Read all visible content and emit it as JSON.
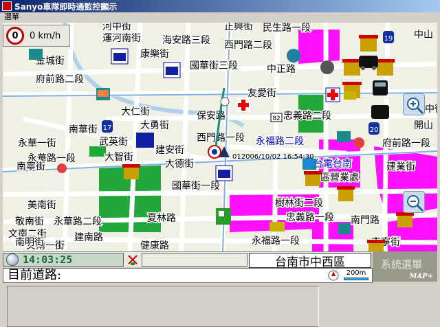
{
  "window": {
    "title": "Sanyo車隊即時通監控顯示"
  },
  "menu": {
    "items": [
      "選單"
    ]
  },
  "speed": {
    "value": "0",
    "unit": "0 km/h"
  },
  "map": {
    "timestamp_label": "012006/10/02 16:54:30",
    "route_badges": [
      "19",
      "17",
      "20",
      "82"
    ],
    "street_labels": [
      {
        "text": "河中街"
      },
      {
        "text": "運河南街"
      },
      {
        "text": "金城街"
      },
      {
        "text": "府前路二段"
      },
      {
        "text": "康樂街"
      },
      {
        "text": "海安路三段"
      },
      {
        "text": "正興街"
      },
      {
        "text": "民生路一段"
      },
      {
        "text": "西門路二段"
      },
      {
        "text": "中山"
      },
      {
        "text": "國華街三段"
      },
      {
        "text": "中正路"
      },
      {
        "text": "府中街"
      },
      {
        "text": "開山"
      },
      {
        "text": "府前路一段"
      },
      {
        "text": "友愛街"
      },
      {
        "text": "忠義路二段"
      },
      {
        "text": "大仁街"
      },
      {
        "text": "大勇街"
      },
      {
        "text": "保安路"
      },
      {
        "text": "南華街"
      },
      {
        "text": "永華一街"
      },
      {
        "text": "永華路一段"
      },
      {
        "text": "武英街"
      },
      {
        "text": "大智街"
      },
      {
        "text": "建安街"
      },
      {
        "text": "大德街"
      },
      {
        "text": "西門路一段"
      },
      {
        "text": "永福路二段"
      },
      {
        "text": "台電台南"
      },
      {
        "text": "區營業處"
      },
      {
        "text": "建業街"
      },
      {
        "text": "南寧街"
      },
      {
        "text": "國華街一段"
      },
      {
        "text": "美南街"
      },
      {
        "text": "敬南街"
      },
      {
        "text": "文南二街"
      },
      {
        "text": "文南一街"
      },
      {
        "text": "建南路"
      },
      {
        "text": "夏林路"
      },
      {
        "text": "永華路二段"
      },
      {
        "text": "南門路"
      },
      {
        "text": "樹林街二段"
      },
      {
        "text": "忠義路一段"
      },
      {
        "text": "永福路一段"
      },
      {
        "text": "南明街"
      },
      {
        "text": "健康路"
      },
      {
        "text": "南寧街"
      }
    ]
  },
  "status": {
    "clock": "14:03:25",
    "district": "台南市中西區",
    "road_label": "目前道路:",
    "scale": "200m"
  },
  "buttons": {
    "system_menu": "系統選單",
    "brand": "MAP+"
  },
  "colors": {
    "park": "#22a83a",
    "zone": "#ff10ff",
    "map_bg": "#f0f0e4",
    "road": "#ffffff",
    "river": "#b0d0ec"
  }
}
